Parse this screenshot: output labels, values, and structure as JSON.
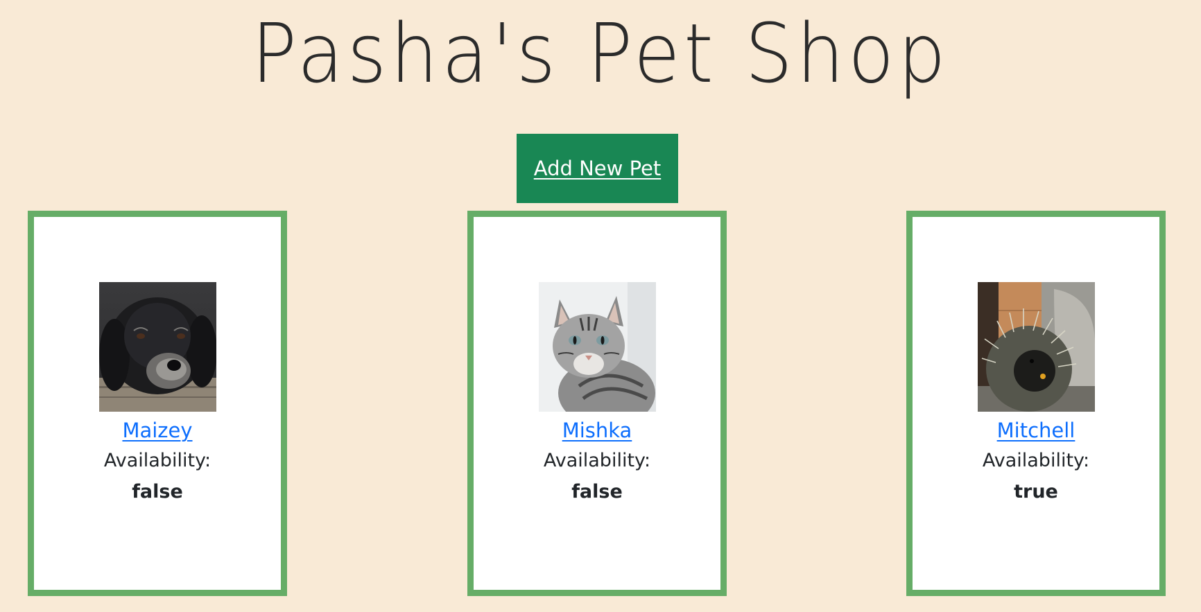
{
  "header": {
    "title": "Pasha's Pet Shop"
  },
  "actions": {
    "add_label": "Add New Pet"
  },
  "pets": [
    {
      "name": "Maizey",
      "availability_label": "Availability:",
      "availability_value": "false",
      "image_alt": "Maizey"
    },
    {
      "name": "Mishka",
      "availability_label": "Availability:",
      "availability_value": "false",
      "image_alt": "Mishka"
    },
    {
      "name": "Mitchell",
      "availability_label": "Availability:",
      "availability_value": "true",
      "image_alt": "Mitchell"
    }
  ],
  "colors": {
    "background": "#f9ead6",
    "button": "#198754",
    "card_border": "#66ad67",
    "link": "#0d6efd"
  }
}
